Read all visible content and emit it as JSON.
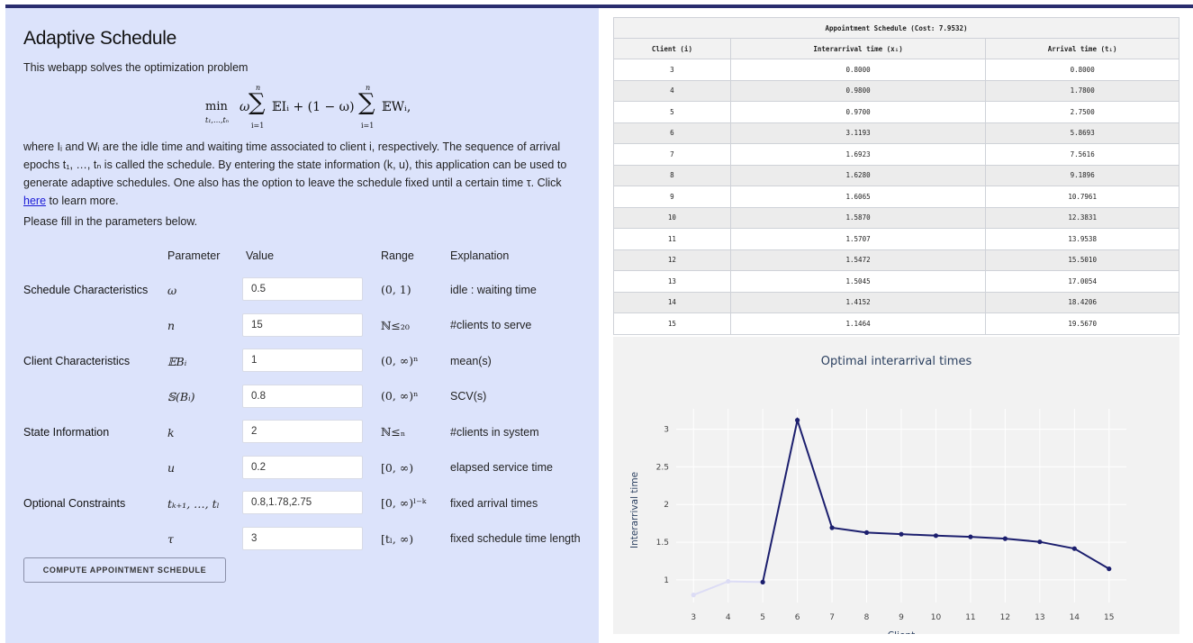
{
  "app": {
    "title": "Adaptive Schedule",
    "intro": "This webapp solves the optimization problem",
    "paragraph_before_link": "where Iᵢ and Wᵢ are the idle time and waiting time associated to client i, respectively. The sequence of arrival epochs t₁, …, tₙ is called the schedule. By entering the state information (k, u), this application can be used to generate adaptive schedules. One also has the option to leave the schedule fixed until a certain time τ. Click ",
    "link_text": "here",
    "paragraph_after_link": " to learn more.",
    "fill_in": "Please fill in the parameters below."
  },
  "formula": {
    "min": "min",
    "min_sub": "t₁,…,tₙ",
    "omega": "ω",
    "sum1_top": "n",
    "sum1_bottom": "i=1",
    "term1": "𝔼Iᵢ + (1 − ω)",
    "sum2_top": "n",
    "sum2_bottom": "i=1",
    "term2": "𝔼Wᵢ,"
  },
  "form": {
    "headers": {
      "parameter": "Parameter",
      "value": "Value",
      "range": "Range",
      "explanation": "Explanation"
    },
    "groups": {
      "schedule": "Schedule Characteristics",
      "client": "Client Characteristics",
      "state": "State Information",
      "optional": "Optional Constraints"
    },
    "rows": [
      {
        "symbol": "ω",
        "value": "0.5",
        "range": "(0, 1)",
        "explanation": "idle : waiting time"
      },
      {
        "symbol": "n",
        "value": "15",
        "range": "ℕ≤₂₀",
        "explanation": "#clients to serve"
      },
      {
        "symbol": "𝔼Bᵢ",
        "value": "1",
        "range": "(0, ∞)ⁿ",
        "explanation": "mean(s)"
      },
      {
        "symbol": "𝕊(Bᵢ)",
        "value": "0.8",
        "range": "(0, ∞)ⁿ",
        "explanation": "SCV(s)"
      },
      {
        "symbol": "k",
        "value": "2",
        "range": "ℕ≤ₙ",
        "explanation": "#clients in system"
      },
      {
        "symbol": "u",
        "value": "0.2",
        "range": "[0, ∞)",
        "explanation": "elapsed service time"
      },
      {
        "symbol": "tₖ₊₁, …, tₗ",
        "value": "0.8,1.78,2.75",
        "range": "[0, ∞)ˡ⁻ᵏ",
        "explanation": "fixed arrival times"
      },
      {
        "symbol": "τ",
        "value": "3",
        "range": "[tₗ, ∞)",
        "explanation": "fixed schedule time length"
      }
    ],
    "compute_button": "COMPUTE APPOINTMENT SCHEDULE"
  },
  "schedule_table": {
    "caption": "Appointment Schedule (Cost: 7.9532)",
    "headers": [
      "Client (i)",
      "Interarrival time (xᵢ)",
      "Arrival time (tᵢ)"
    ],
    "rows": [
      [
        "3",
        "0.8000",
        "0.8000"
      ],
      [
        "4",
        "0.9800",
        "1.7800"
      ],
      [
        "5",
        "0.9700",
        "2.7500"
      ],
      [
        "6",
        "3.1193",
        "5.8693"
      ],
      [
        "7",
        "1.6923",
        "7.5616"
      ],
      [
        "8",
        "1.6280",
        "9.1896"
      ],
      [
        "9",
        "1.6065",
        "10.7961"
      ],
      [
        "10",
        "1.5870",
        "12.3831"
      ],
      [
        "11",
        "1.5707",
        "13.9538"
      ],
      [
        "12",
        "1.5472",
        "15.5010"
      ],
      [
        "13",
        "1.5045",
        "17.0054"
      ],
      [
        "14",
        "1.4152",
        "18.4206"
      ],
      [
        "15",
        "1.1464",
        "19.5670"
      ]
    ]
  },
  "chart_data": {
    "type": "line",
    "title": "Optimal interarrival times",
    "xlabel": "Client",
    "ylabel": "Interarrival time",
    "x": [
      3,
      4,
      5,
      6,
      7,
      8,
      9,
      10,
      11,
      12,
      13,
      14,
      15
    ],
    "series": [
      {
        "values": [
          0.8,
          0.98,
          0.97
        ],
        "color": "#dcdcf5"
      },
      {
        "values": [
          null,
          null,
          0.97,
          3.1193,
          1.6923,
          1.628,
          1.6065,
          1.587,
          1.5707,
          1.5472,
          1.5045,
          1.4152,
          1.1464
        ],
        "color": "#1c1f6e"
      }
    ],
    "xticks": [
      "3",
      "4",
      "5",
      "6",
      "7",
      "8",
      "9",
      "10",
      "11",
      "12",
      "13",
      "14",
      "15"
    ],
    "yticks": [
      1,
      1.5,
      2,
      2.5,
      3
    ],
    "ytick_labels": [
      "1",
      "1.5",
      "2",
      "2.5",
      "3"
    ],
    "xlim": [
      2.5,
      15.5
    ],
    "ylim": [
      0.7,
      3.27
    ],
    "grid": true
  },
  "colors": {
    "panel_bg": "#dce3fb",
    "accent_bar": "#2a2d6e",
    "link": "#1a1ad6",
    "line_main": "#1c1f6e",
    "line_fixed": "#dcdcf5"
  }
}
